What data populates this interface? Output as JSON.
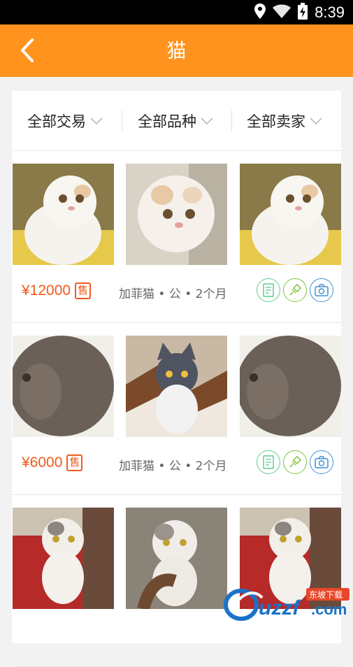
{
  "status_bar": {
    "time": "8:39",
    "icons": [
      "location-icon",
      "wifi-icon",
      "battery-charging-icon"
    ]
  },
  "app_bar": {
    "title": "猫",
    "back_icon": "chevron-left-icon"
  },
  "colors": {
    "accent": "#ff931e",
    "price": "#f05a1e",
    "cert_green": "#5fce8a",
    "health_green": "#7cc43a",
    "photo_blue": "#3d8fd6"
  },
  "filters": [
    {
      "label": "全部交易"
    },
    {
      "label": "全部品种"
    },
    {
      "label": "全部卖家"
    }
  ],
  "listings": [
    {
      "price": "¥12000",
      "badge": "售",
      "info": "加菲猫 • 公 • 2个月",
      "photos": [
        "white-kitten",
        "white-kitten-closeup",
        "white-kitten"
      ]
    },
    {
      "price": "¥6000",
      "badge": "售",
      "info": "加菲猫 • 公 • 2个月",
      "photos": [
        "gray-kitten",
        "gray-white-kitten",
        "gray-kitten"
      ]
    },
    {
      "price": "",
      "badge": "",
      "info": "",
      "photos": [
        "calico-kitten",
        "calico-kitten-held",
        "calico-kitten"
      ]
    }
  ],
  "watermark": {
    "brand": "uzzf.com",
    "tag": "东坡下载"
  }
}
